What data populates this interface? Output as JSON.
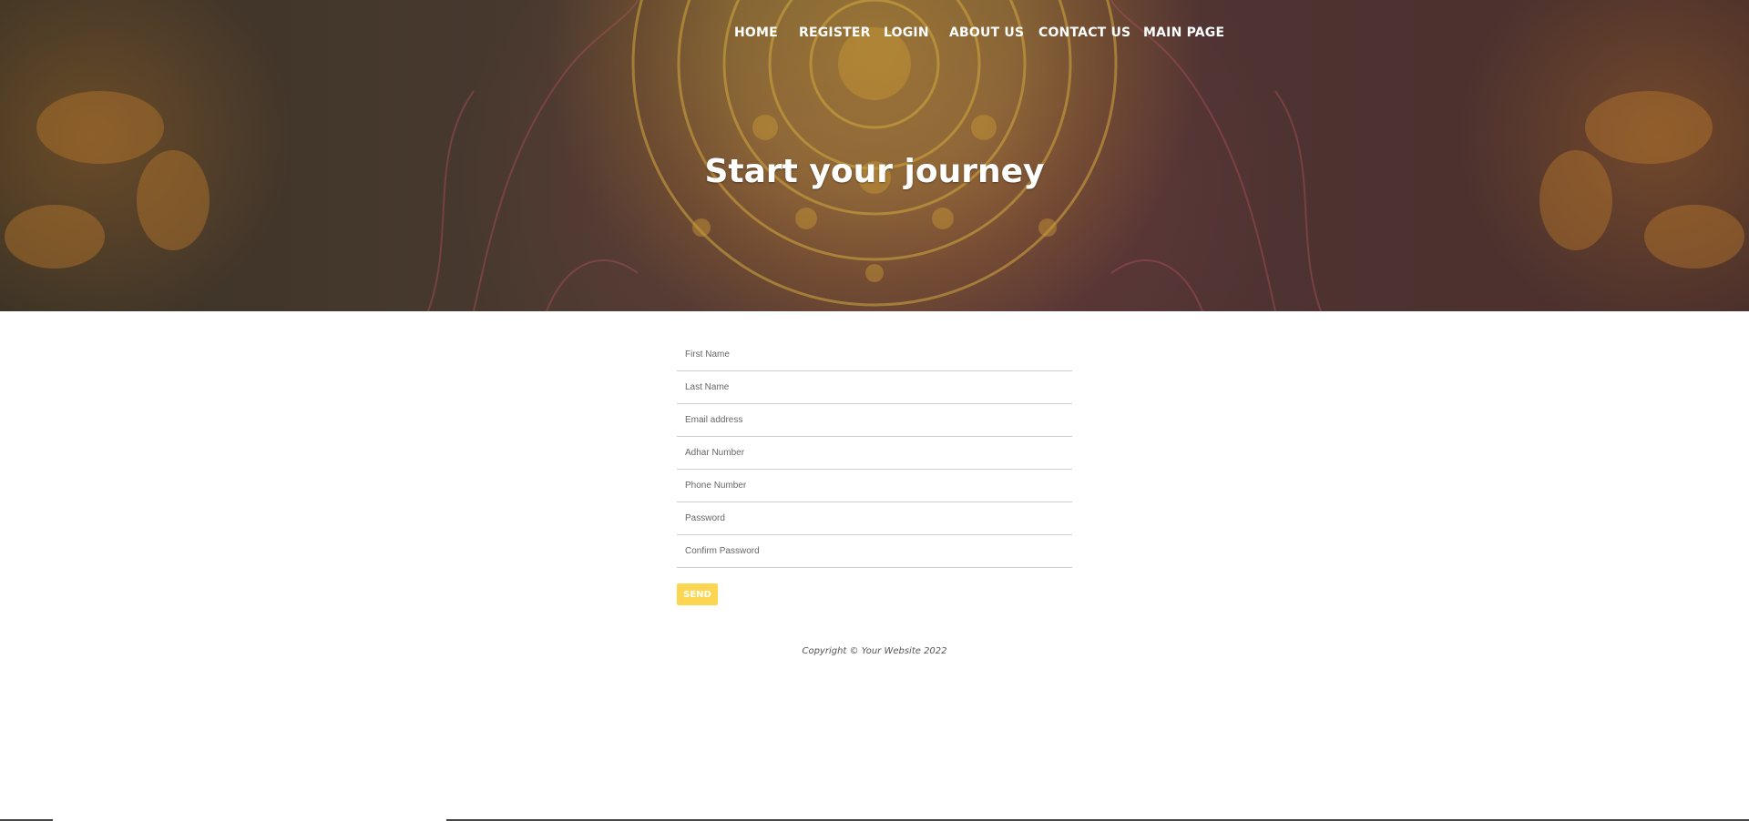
{
  "nav": {
    "items": [
      {
        "label": "HOME"
      },
      {
        "label": "REGISTER"
      },
      {
        "label": "LOGIN"
      },
      {
        "label": "ABOUT US"
      },
      {
        "label": "CONTACT US"
      },
      {
        "label": "MAIN PAGE"
      }
    ]
  },
  "hero": {
    "title": "Start your journey"
  },
  "form": {
    "fields": [
      {
        "placeholder": "First Name",
        "value": ""
      },
      {
        "placeholder": "Last Name",
        "value": ""
      },
      {
        "placeholder": "Email address",
        "value": ""
      },
      {
        "placeholder": "Adhar Number",
        "value": ""
      },
      {
        "placeholder": "Phone Number",
        "value": ""
      },
      {
        "placeholder": "Password",
        "value": ""
      },
      {
        "placeholder": "Confirm Password",
        "value": ""
      }
    ],
    "submit_label": "SEND"
  },
  "footer": {
    "copyright": "Copyright © Your Website 2022"
  },
  "colors": {
    "accent": "#fcd651",
    "hero_gold": "#c9a53a",
    "hero_rose": "#b2505a",
    "hero_dark": "#4a3a30"
  }
}
